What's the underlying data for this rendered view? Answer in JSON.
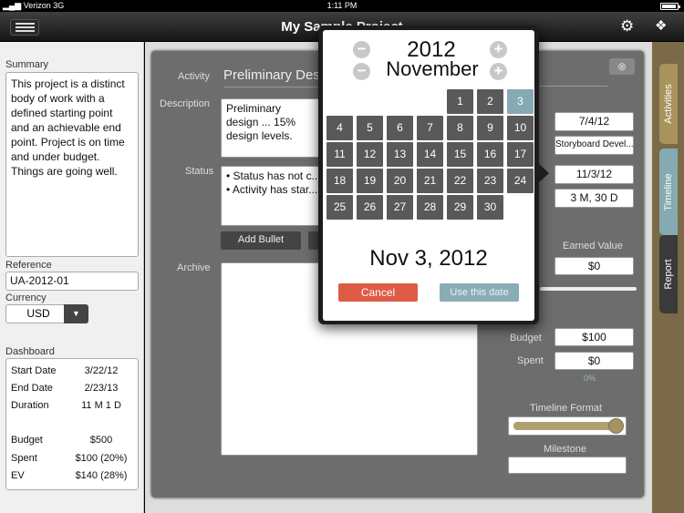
{
  "statusbar": {
    "carrier": "Verizon",
    "network": "3G",
    "time": "1:11 PM"
  },
  "nav": {
    "title": "My Sample Project",
    "menu_icon": "menu-icon",
    "settings_icon": "gear-icon",
    "dropbox_icon": "dropbox-icon"
  },
  "sidebar": {
    "summary_label": "Summary",
    "summary_text": "This project is a distinct body of work with a defined starting point and an achievable end point. Project is on time and under budget. Things are going well.",
    "reference_label": "Reference",
    "reference_value": "UA-2012-01",
    "currency_label": "Currency",
    "currency_value": "USD",
    "dashboard_label": "Dashboard",
    "dashboard": {
      "start_date_label": "Start Date",
      "start_date": "3/22/12",
      "end_date_label": "End Date",
      "end_date": "2/23/13",
      "duration_label": "Duration",
      "duration": "11 M 1 D",
      "budget_label": "Budget",
      "budget": "$500",
      "spent_label": "Spent",
      "spent": "$100 (20%)",
      "ev_label": "EV",
      "ev": "$140 (28%)"
    }
  },
  "activity": {
    "activity_label": "Activity",
    "activity_name": "Preliminary Design",
    "description_label": "Description",
    "description_text": "Preliminary design ... 15% design levels.",
    "status_label": "Status",
    "status_bullets": [
      "Status has not c...",
      "Activity has star..."
    ],
    "add_bullet_label": "Add Bullet",
    "archive_label": "Archive",
    "start_value": "7/4/12",
    "predecessor_value": "Storyboard Devel...",
    "end_value": "11/3/12",
    "duration_value": "3 M, 30 D",
    "earned_value_label": "Earned Value",
    "earned_value": "$0",
    "budget_label": "Budget",
    "budget_value": "$100",
    "spent_label": "Spent",
    "spent_value": "$0",
    "spent_percent": "0%",
    "timeline_format_label": "Timeline Format",
    "milestone_label": "Milestone",
    "milestone_value": ""
  },
  "tabs": {
    "activities": "Activities",
    "timeline": "Timeline",
    "report": "Report"
  },
  "datepicker": {
    "year": "2012",
    "month": "November",
    "days": [
      "1",
      "2",
      "3",
      "4",
      "5",
      "6",
      "7",
      "8",
      "9",
      "10",
      "11",
      "12",
      "13",
      "14",
      "15",
      "16",
      "17",
      "18",
      "19",
      "20",
      "21",
      "22",
      "23",
      "24",
      "25",
      "26",
      "27",
      "28",
      "29",
      "30"
    ],
    "selected_day": "3",
    "selected_date_text": "Nov 3, 2012",
    "cancel_label": "Cancel",
    "use_label": "Use this date"
  }
}
